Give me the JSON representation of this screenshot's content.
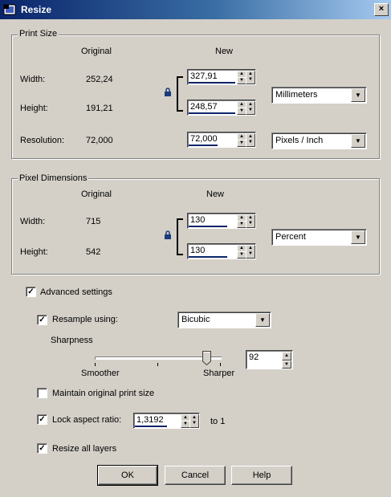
{
  "window": {
    "title": "Resize",
    "close_glyph": "×"
  },
  "print_size": {
    "title": "Print Size",
    "col_original": "Original",
    "col_new": "New",
    "width_label": "Width:",
    "width_original": "252,24",
    "width_new": "327,91",
    "height_label": "Height:",
    "height_original": "191,21",
    "height_new": "248,57",
    "resolution_label": "Resolution:",
    "resolution_original": "72,000",
    "resolution_new": "72,000",
    "units": "Millimeters",
    "res_units": "Pixels / Inch"
  },
  "pixel_dimensions": {
    "title": "Pixel Dimensions",
    "col_original": "Original",
    "col_new": "New",
    "width_label": "Width:",
    "width_original": "715",
    "width_new": "130",
    "height_label": "Height:",
    "height_original": "542",
    "height_new": "130",
    "units": "Percent"
  },
  "advanced": {
    "label": "Advanced settings",
    "checked": true,
    "resample_label": "Resample using:",
    "resample_checked": true,
    "resample_method": "Bicubic",
    "sharpness_label": "Sharpness",
    "smoother_label": "Smoother",
    "sharper_label": "Sharper",
    "sharpness_value": "92",
    "maintain_label": "Maintain original print size",
    "maintain_checked": false,
    "lock_label": "Lock aspect ratio:",
    "lock_checked": true,
    "aspect_value": "1,3192",
    "to_one": "to 1",
    "resize_layers_label": "Resize all layers",
    "resize_layers_checked": true
  },
  "buttons": {
    "ok": "OK",
    "cancel": "Cancel",
    "help": "Help"
  }
}
